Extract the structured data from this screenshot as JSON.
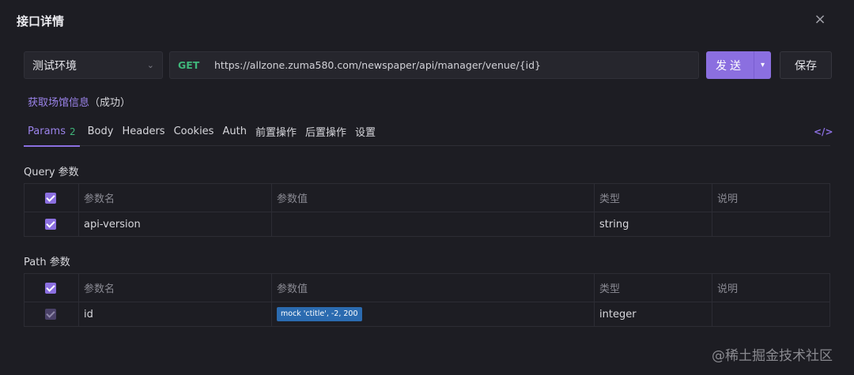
{
  "dialog": {
    "title": "接口详情",
    "close_glyph": "×"
  },
  "env": {
    "value": "测试环境"
  },
  "request": {
    "method": "GET",
    "url": "https://allzone.zuma580.com/newspaper/api/manager/venue/{id}",
    "send_label": "发送",
    "save_label": "保存"
  },
  "api": {
    "name": "获取场馆信息",
    "status": "（成功）"
  },
  "tabs": [
    {
      "label": "Params",
      "badge": "2",
      "active": true
    },
    {
      "label": "Body"
    },
    {
      "label": "Headers"
    },
    {
      "label": "Cookies"
    },
    {
      "label": "Auth"
    },
    {
      "label": "前置操作"
    },
    {
      "label": "后置操作"
    },
    {
      "label": "设置"
    }
  ],
  "code_icon": "</>",
  "headers": {
    "name": "参数名",
    "value": "参数值",
    "type": "类型",
    "desc": "说明"
  },
  "query": {
    "title": "Query 参数",
    "rows": [
      {
        "name": "api-version",
        "value": "",
        "type": "string",
        "desc": ""
      }
    ]
  },
  "path": {
    "title": "Path 参数",
    "rows": [
      {
        "name": "id",
        "value": "mock 'ctitle', -2, 200",
        "type": "integer",
        "desc": ""
      }
    ]
  },
  "watermark": "@稀土掘金技术社区",
  "colors": {
    "accent": "#8b6fe0",
    "get": "#3fb67a",
    "background": "#1d1d23",
    "mock": "#2b6bb0"
  }
}
